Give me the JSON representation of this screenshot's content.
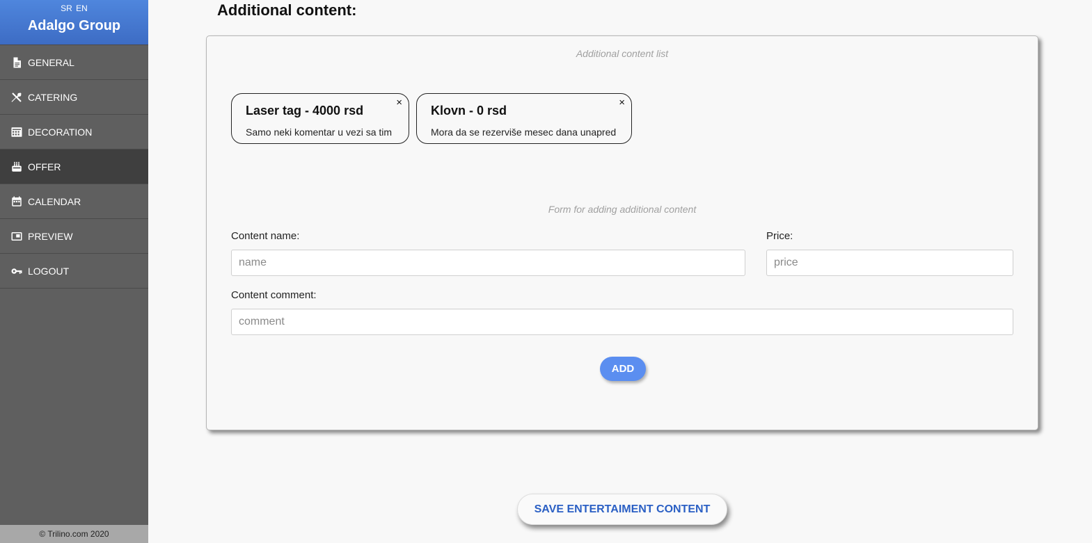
{
  "sidebar": {
    "languages": [
      "SR",
      "EN"
    ],
    "brand": "Adalgo Group",
    "items": [
      {
        "label": "GENERAL",
        "icon": "document-icon"
      },
      {
        "label": "CATERING",
        "icon": "utensils-icon"
      },
      {
        "label": "DECORATION",
        "icon": "decoration-icon"
      },
      {
        "label": "OFFER",
        "icon": "cake-icon",
        "active": true
      },
      {
        "label": "CALENDAR",
        "icon": "calendar-icon"
      },
      {
        "label": "PREVIEW",
        "icon": "preview-icon"
      },
      {
        "label": "LOGOUT",
        "icon": "key-icon"
      }
    ],
    "footer": "© Trilino.com 2020"
  },
  "main": {
    "title": "Additional content:",
    "list_caption": "Additional content list",
    "items": [
      {
        "title": "Laser tag - 4000 rsd",
        "comment": "Samo neki komentar u vezi sa tim",
        "close": "×"
      },
      {
        "title": "Klovn - 0 rsd",
        "comment": "Mora da se rezerviše mesec dana unapred",
        "close": "×"
      }
    ],
    "form_caption": "Form for adding additional content",
    "name_label": "Content name:",
    "name_placeholder": "name",
    "price_label": "Price:",
    "price_placeholder": "price",
    "comment_label": "Content comment:",
    "comment_placeholder": "comment",
    "add_label": "ADD",
    "save_label": "SAVE ENTERTAIMENT CONTENT"
  },
  "colors": {
    "sidebar_bg": "#5f5f5f",
    "sidebar_active": "#3f3f3f",
    "brand_blue": "#4a7fd8",
    "add_button": "#5b8ef0",
    "save_text": "#2a5fc4"
  }
}
